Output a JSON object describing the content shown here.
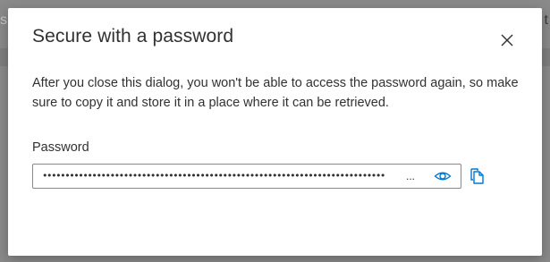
{
  "background": {
    "left_glyph": "s",
    "right_glyph": "t"
  },
  "dialog": {
    "title": "Secure with a password",
    "description": "After you close this dialog, you won't be able to access the password again, so make sure to copy it and store it in a place where it can be retrieved.",
    "password_label": "Password",
    "password_masked": "••••••••••••••••••••••••••••••••••••••••••••••••••••••••••••••••••••••••••••",
    "password_ellipsis": "...",
    "icons": {
      "close": "close-icon",
      "reveal": "eye-icon",
      "copy": "copy-icon"
    },
    "accent_color": "#0078d4"
  }
}
